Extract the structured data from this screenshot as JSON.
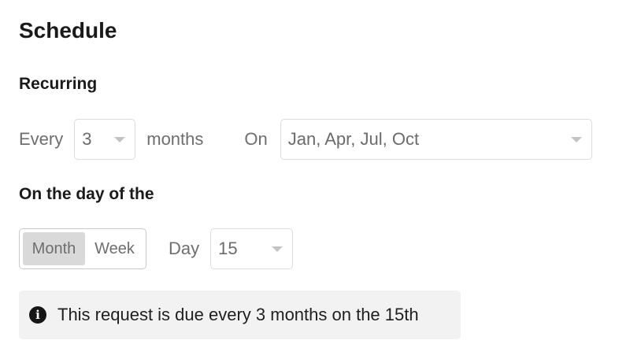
{
  "schedule": {
    "title": "Schedule",
    "recurring": {
      "heading": "Recurring",
      "every_label": "Every",
      "interval_value": "3",
      "unit_label": "months",
      "on_label": "On",
      "months_value": "Jan, Apr, Jul, Oct"
    },
    "day_of": {
      "heading": "On the day of the",
      "toggle": {
        "options": [
          "Month",
          "Week"
        ],
        "selected": "Month"
      },
      "day_label": "Day",
      "day_value": "15"
    },
    "info": {
      "icon": "info-circle-icon",
      "message": "This request is due every 3 months on the 15th"
    }
  }
}
